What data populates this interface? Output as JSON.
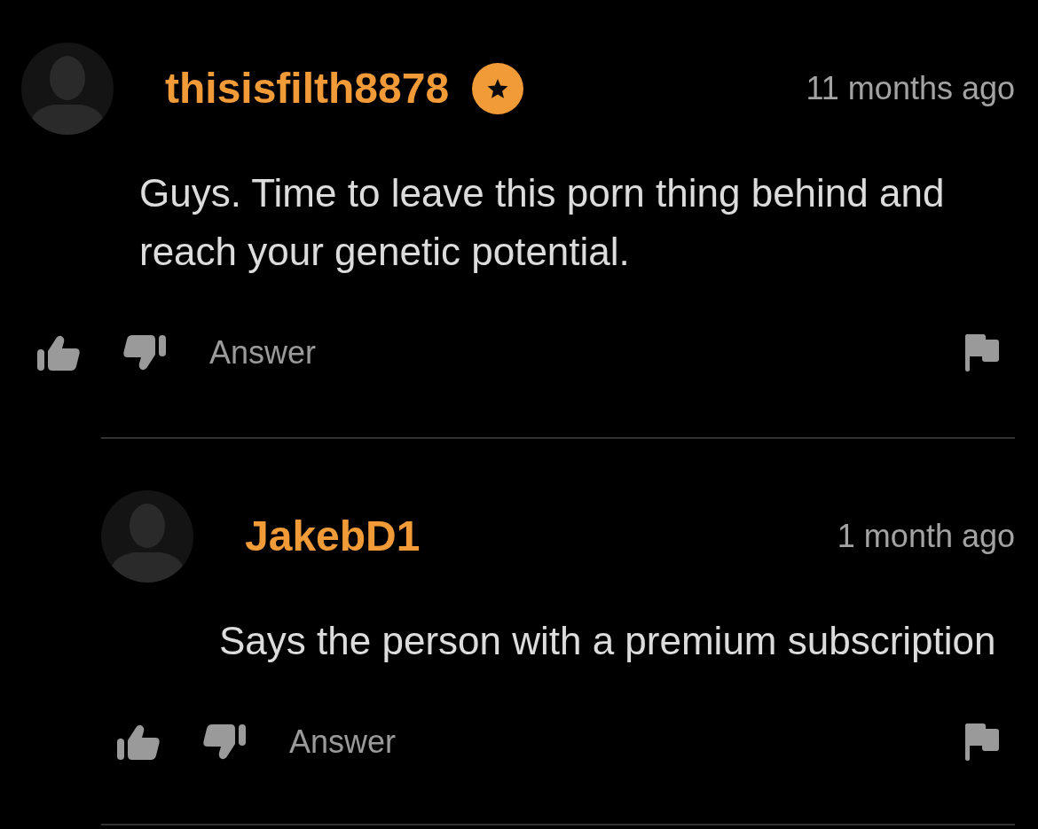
{
  "comments": [
    {
      "username": "thisisfilth8878",
      "badge": true,
      "time": "11 months ago",
      "text": "Guys. Time to leave this porn thing behind and reach your genetic potential.",
      "answer_label": "Answer",
      "replies": [
        {
          "username": "JakebD1",
          "badge": false,
          "time": "1 month ago",
          "text": "Says the person with a premium subscription",
          "answer_label": "Answer"
        }
      ]
    }
  ]
}
